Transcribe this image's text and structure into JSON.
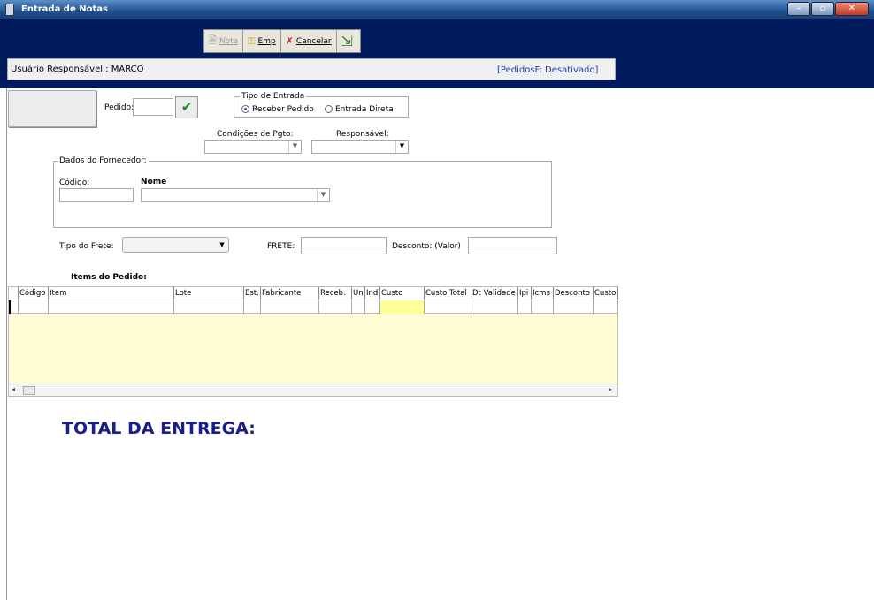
{
  "window": {
    "title": "Entrada de Notas",
    "controls": [
      "minimize",
      "maximize",
      "close"
    ]
  },
  "toolbar": {
    "nota": "Nota",
    "emp": "Emp",
    "cancelar": "Cancelar"
  },
  "userbar": {
    "user": "Usuário Responsável : MARCO",
    "status": "[PedidosF: Desativado]"
  },
  "pedido": {
    "label": "Pedido:",
    "value": ""
  },
  "tipo_entrada": {
    "legend": "Tipo de Entrada",
    "options": [
      "Receber Pedido",
      "Entrada Direta"
    ],
    "selected": "Receber Pedido"
  },
  "condicoes": {
    "label": "Condições de Pgto:",
    "value": ""
  },
  "responsavel": {
    "label": "Responsável:",
    "value": ""
  },
  "fornecedor": {
    "legend": "Dados do Fornecedor:",
    "codigo_label": "Código:",
    "nome_label": "Nome",
    "codigo_value": "",
    "nome_value": ""
  },
  "frete": {
    "tipo_label": "Tipo do Frete:",
    "frete_label": "FRETE:",
    "desconto_label": "Desconto: (Valor)",
    "frete_value": "",
    "desconto_value": ""
  },
  "items": {
    "title": "Items do Pedido:",
    "columns": [
      "Código",
      "Item",
      "Lote",
      "Est.",
      "Fabricante",
      "Receb.",
      "Un",
      "Ind",
      "Custo",
      "Custo Total",
      "Dt Validade",
      "Ipi",
      "Icms",
      "Desconto",
      "Custo"
    ]
  },
  "total": {
    "label": "TOTAL DA ENTREGA:"
  },
  "colors": {
    "band": "#001b5e",
    "grid_bg": "#fffbd4",
    "custo_cell": "#ffff99",
    "total": "#1a1e8c"
  }
}
